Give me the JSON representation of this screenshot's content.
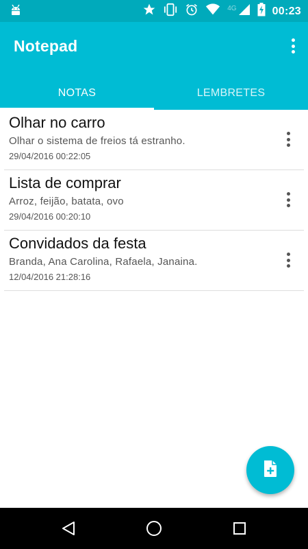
{
  "status_bar": {
    "time": "00:23",
    "network": "4G",
    "icons": [
      "android-icon",
      "star-icon",
      "vibrate-icon",
      "alarm-icon",
      "wifi-icon",
      "signal-icon",
      "battery-charging-icon"
    ]
  },
  "app_bar": {
    "title": "Notepad",
    "overflow_icon": "more-vert-icon",
    "color": "#00bcd4"
  },
  "tabs": [
    {
      "label": "NOTAS",
      "selected": true
    },
    {
      "label": "LEMBRETES",
      "selected": false
    }
  ],
  "notes": [
    {
      "title": "Olhar no carro",
      "body": "Olhar o sistema de freios  tá estranho.",
      "date": "29/04/2016 00:22:05"
    },
    {
      "title": "Lista de comprar",
      "body": "Arroz,  feijão,  batata,  ovo",
      "date": "29/04/2016 00:20:10"
    },
    {
      "title": "Convidados da festa",
      "body": "Branda,  Ana Carolina,  Rafaela,  Janaina.",
      "date": "12/04/2016 21:28:16"
    }
  ],
  "fab": {
    "icon": "note-add-icon"
  },
  "nav_bar": {
    "icons": [
      "back-icon",
      "home-icon",
      "recents-icon"
    ]
  }
}
